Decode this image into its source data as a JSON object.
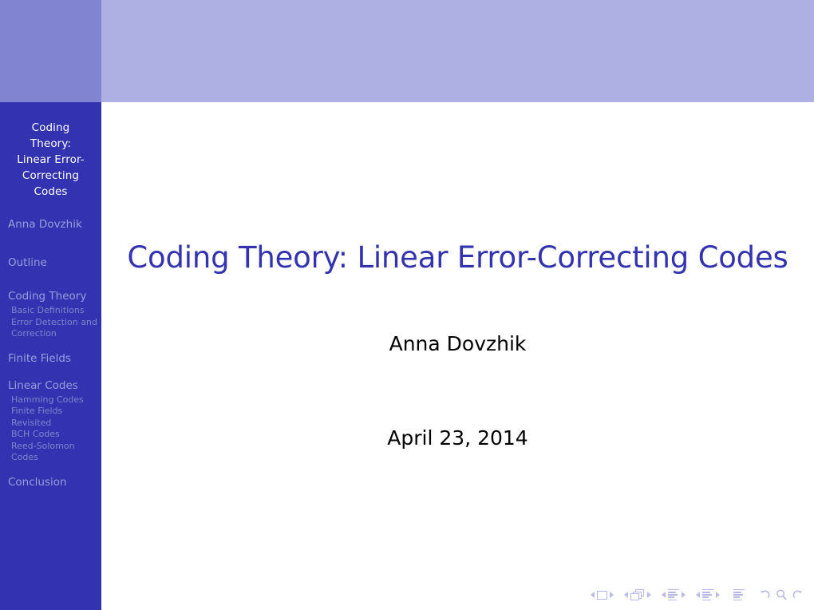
{
  "theme": {
    "sidebar_bg": "#3333b1",
    "banner_left": "#8184d1",
    "banner_right": "#aeb0e3",
    "title_color": "#3333b1",
    "nav_icon_color": "#b6b8e6",
    "sidebar_section_color": "#9a9ddb",
    "sidebar_sub_color": "#8083cb",
    "page_bg": "#ffffff"
  },
  "sidebar": {
    "short_title_lines": [
      "Coding",
      "Theory:",
      "Linear Error-",
      "Correcting",
      "Codes"
    ],
    "author": "Anna Dovzhik",
    "outline_label": "Outline",
    "sections": [
      {
        "label": "Coding Theory",
        "subsections": [
          "Basic Definitions",
          "Error Detection and Correction"
        ]
      },
      {
        "label": "Finite Fields",
        "subsections": []
      },
      {
        "label": "Linear Codes",
        "subsections": [
          "Hamming Codes",
          "Finite Fields Revisited",
          "BCH Codes",
          "Reed-Solomon Codes"
        ]
      },
      {
        "label": "Conclusion",
        "subsections": []
      }
    ]
  },
  "main": {
    "title": "Coding Theory: Linear Error-Correcting Codes",
    "author": "Anna Dovzhik",
    "date": "April 23, 2014"
  },
  "navigation": {
    "groups": [
      {
        "icon": "single-frame-icon",
        "prev": "previous-slide",
        "next": "next-slide"
      },
      {
        "icon": "stacked-frames-icon",
        "prev": "previous-frame",
        "next": "next-frame"
      },
      {
        "icon": "subsection-lines-icon",
        "prev": "previous-subsection",
        "next": "next-subsection"
      },
      {
        "icon": "section-lines-icon",
        "prev": "previous-section",
        "next": "next-section"
      }
    ],
    "document_icon": "document-lines-icon",
    "controls": [
      "back-arrow-icon",
      "search-icon",
      "forward-arrow-icon"
    ]
  }
}
